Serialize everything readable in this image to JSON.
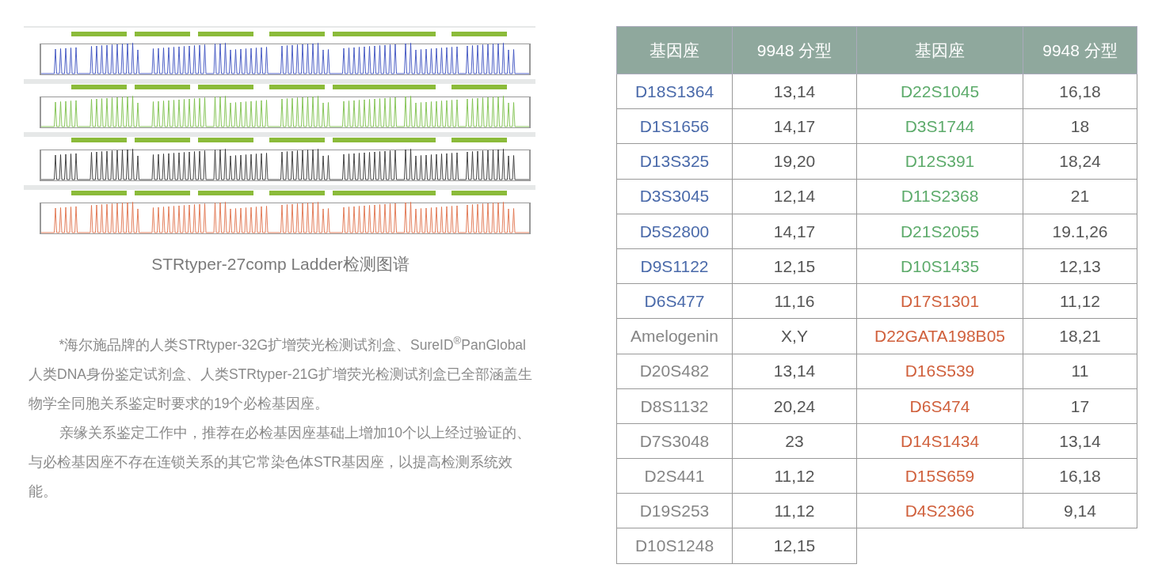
{
  "figure": {
    "kind": "picture",
    "caption": "STRtyper-27comp  Ladder检测图谱"
  },
  "notes": [
    "*海尔施品牌的人类STRtyper-32G扩增荧光检测试剂盒、SureID$^{®}$PanGlobal人类DNA身份鉴定试剂盒、人类STRtyper-21G扩增荧光检测试剂盒已全部涵盖生物学全同胞关系鉴定时要求的19个必检基因座。",
    "亲缘关系鉴定工作中，推荐在必检基因座基础上增加10个以上经过验证的、与必检基因座不存在连锁关系的其它常染色体STR基因座，以提高检测系统效能。"
  ],
  "table": {
    "columns": [
      "基因座",
      "9948 分型",
      "基因座",
      "9948 分型"
    ],
    "rows": [
      {
        "left": {
          "locus": "D18S1364",
          "genotype": "13,14",
          "color": "#4a6aaa"
        },
        "right": {
          "locus": "D22S1045",
          "genotype": "16,18",
          "color": "#5dab6b"
        }
      },
      {
        "left": {
          "locus": "D1S1656",
          "genotype": "14,17",
          "color": "#4a6aaa"
        },
        "right": {
          "locus": "D3S1744",
          "genotype": "18",
          "color": "#5dab6b"
        }
      },
      {
        "left": {
          "locus": "D13S325",
          "genotype": "19,20",
          "color": "#4a6aaa"
        },
        "right": {
          "locus": "D12S391",
          "genotype": "18,24",
          "color": "#5dab6b"
        }
      },
      {
        "left": {
          "locus": "D3S3045",
          "genotype": "12,14",
          "color": "#4a6aaa"
        },
        "right": {
          "locus": "D11S2368",
          "genotype": "21",
          "color": "#5dab6b"
        }
      },
      {
        "left": {
          "locus": "D5S2800",
          "genotype": "14,17",
          "color": "#4a6aaa"
        },
        "right": {
          "locus": "D21S2055",
          "genotype": "19.1,26",
          "color": "#5dab6b"
        }
      },
      {
        "left": {
          "locus": "D9S1122",
          "genotype": "12,15",
          "color": "#4a6aaa"
        },
        "right": {
          "locus": "D10S1435",
          "genotype": "12,13",
          "color": "#5dab6b"
        }
      },
      {
        "left": {
          "locus": "D6S477",
          "genotype": "11,16",
          "color": "#4a6aaa"
        },
        "right": {
          "locus": "D17S1301",
          "genotype": "11,12",
          "color": "#d0603c"
        }
      },
      {
        "left": {
          "locus": "Amelogenin",
          "genotype": "X,Y",
          "color": "#858585"
        },
        "right": {
          "locus": "D22GATA198B05",
          "genotype": "18,21",
          "color": "#d0603c"
        }
      },
      {
        "left": {
          "locus": "D20S482",
          "genotype": "13,14",
          "color": "#858585"
        },
        "right": {
          "locus": "D16S539",
          "genotype": "11",
          "color": "#d0603c"
        }
      },
      {
        "left": {
          "locus": "D8S1132",
          "genotype": "20,24",
          "color": "#858585"
        },
        "right": {
          "locus": "D6S474",
          "genotype": "17",
          "color": "#d0603c"
        }
      },
      {
        "left": {
          "locus": "D7S3048",
          "genotype": "23",
          "color": "#858585"
        },
        "right": {
          "locus": "D14S1434",
          "genotype": "13,14",
          "color": "#d0603c"
        }
      },
      {
        "left": {
          "locus": "D2S441",
          "genotype": "11,12",
          "color": "#858585"
        },
        "right": {
          "locus": "D15S659",
          "genotype": "16,18",
          "color": "#d0603c"
        }
      },
      {
        "left": {
          "locus": "D19S253",
          "genotype": "11,12",
          "color": "#858585"
        },
        "right": {
          "locus": "D4S2366",
          "genotype": "9,14",
          "color": "#d0603c"
        }
      },
      {
        "left": {
          "locus": "D10S1248",
          "genotype": "12,15",
          "color": "#858585"
        }
      }
    ]
  }
}
